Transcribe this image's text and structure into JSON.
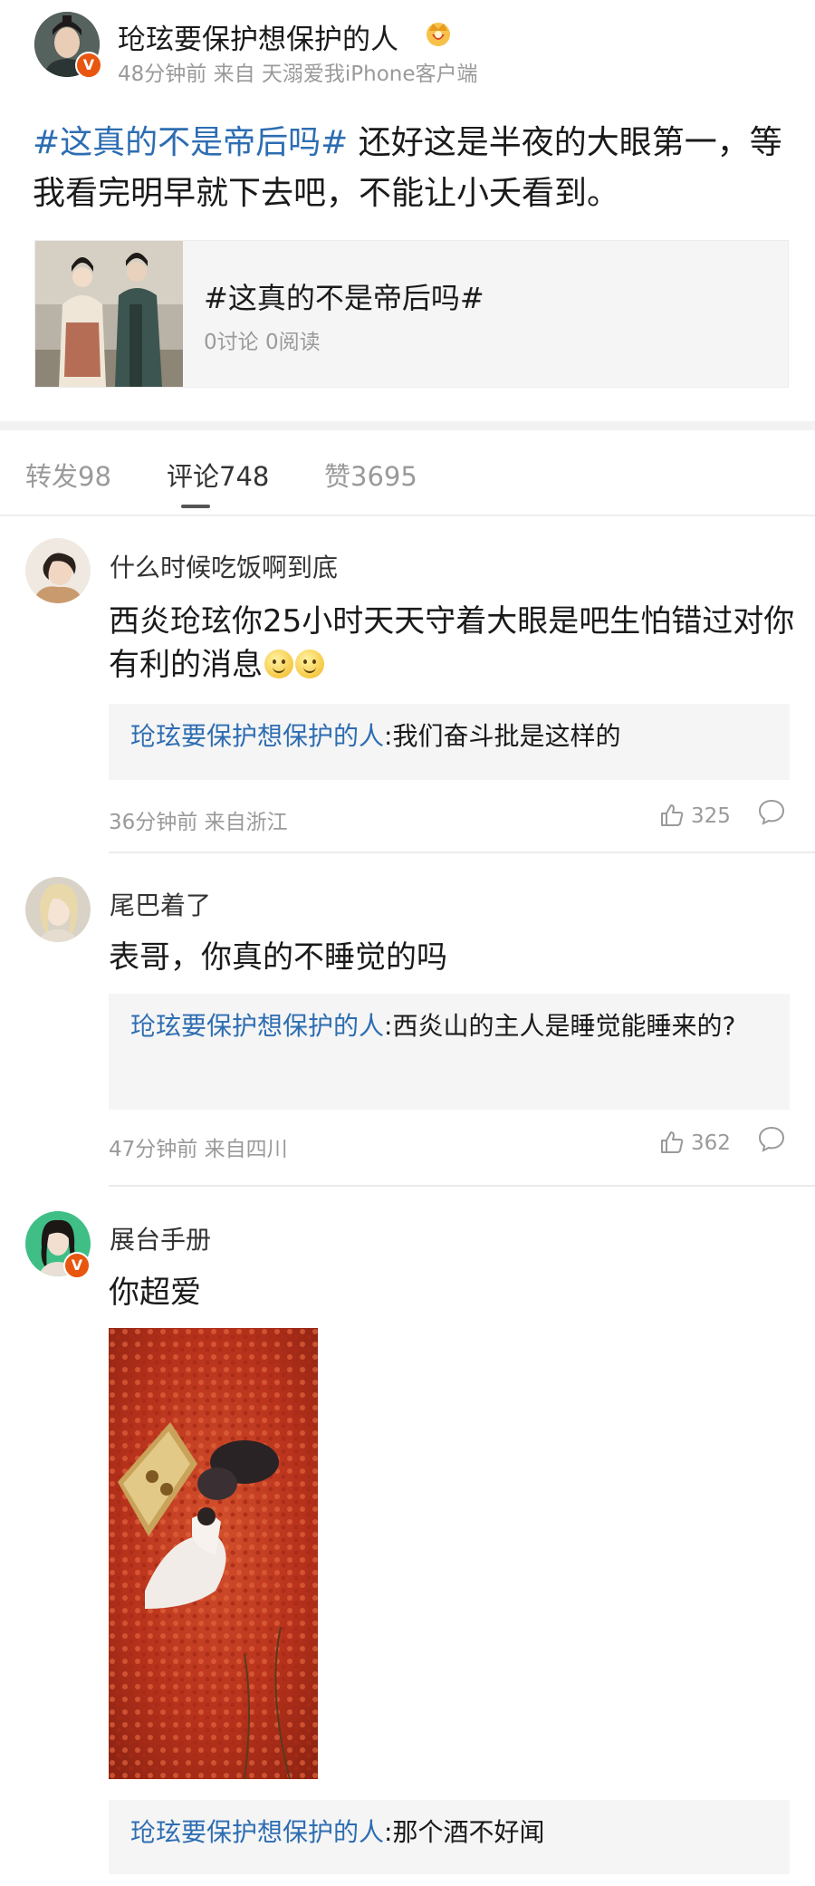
{
  "post": {
    "author": "玱玹要保护想保护的人",
    "meta": "48分钟前 来自 天溺爱我iPhone客户端",
    "hashtag": "#这真的不是帝后吗#",
    "text": " 还好这是半夜的大眼第一，等我看完明早就下去吧，不能让小夭看到。",
    "badge": "V",
    "crown_icon": "crown-icon"
  },
  "topic_card": {
    "title": "#这真的不是帝后吗#",
    "stats": "0讨论 0阅读"
  },
  "tabs": [
    {
      "label": "转发98",
      "active": false
    },
    {
      "label": "评论748",
      "active": true
    },
    {
      "label": "赞3695",
      "active": false
    }
  ],
  "comments": [
    {
      "name": "什么时候吃饭啊到底",
      "text": "西炎玱玹你25小时天天守着大眼是吧生怕错过对你有利的消息",
      "reply_name": "玱玹要保护想保护的人",
      "reply_text": ":我们奋斗批是这样的",
      "meta": "36分钟前 来自浙江",
      "likes": "325"
    },
    {
      "name": "尾巴着了",
      "text": "表哥，你真的不睡觉的吗",
      "reply_name": "玱玹要保护想保护的人",
      "reply_text": ":西炎山的主人是睡觉能睡来的?",
      "meta": "47分钟前 来自四川",
      "likes": "362"
    },
    {
      "name": "展台手册",
      "text": "你超爱",
      "reply_name": "玱玹要保护想保护的人",
      "reply_text": ":那个酒不好闻",
      "badge": "V"
    }
  ],
  "colors": {
    "link": "#2d6db2",
    "badge": "#e8560f",
    "meta": "#9a9a9a"
  }
}
